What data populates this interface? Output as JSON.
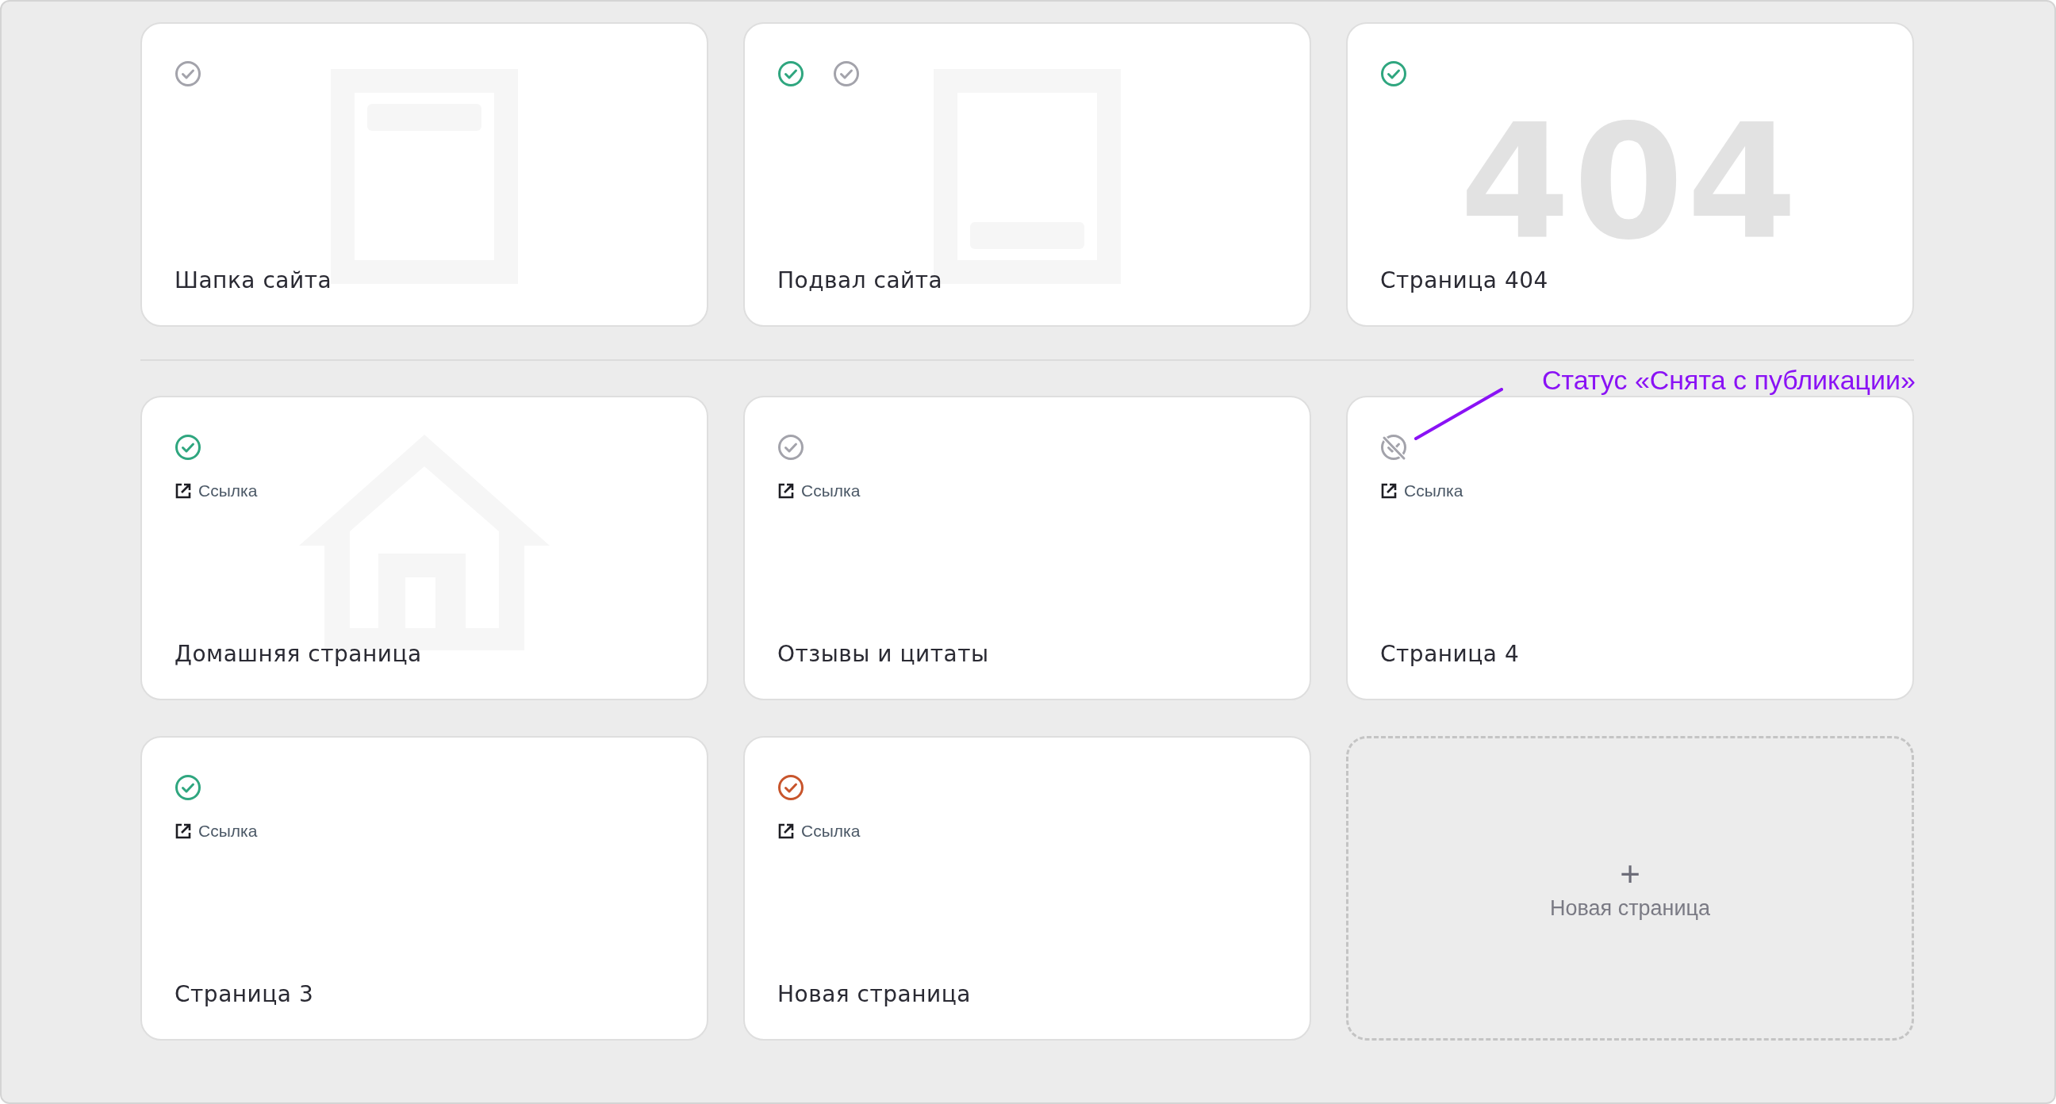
{
  "sections": [
    {
      "cards": [
        {
          "kind": "page",
          "title": "Шапка сайта",
          "illustration": {
            "kind": "header"
          },
          "statuses": [
            {
              "kind": "inactive"
            }
          ]
        },
        {
          "kind": "page",
          "title": "Подвал сайта",
          "illustration": {
            "kind": "footer"
          },
          "statuses": [
            {
              "kind": "published"
            },
            {
              "kind": "inactive"
            }
          ]
        },
        {
          "kind": "page",
          "title": "Страница 404",
          "illustration": {
            "kind": "error-code",
            "text": "404"
          },
          "statuses": [
            {
              "kind": "published"
            }
          ]
        }
      ]
    },
    {
      "cards": [
        {
          "kind": "page",
          "title": "Домашняя страница",
          "illustration": {
            "kind": "home"
          },
          "statuses": [
            {
              "kind": "published"
            }
          ],
          "link": "Ссылка"
        },
        {
          "kind": "page",
          "title": "Отзывы и цитаты",
          "statuses": [
            {
              "kind": "inactive"
            }
          ],
          "link": "Ссылка"
        },
        {
          "kind": "page",
          "title": "Страница 4",
          "statuses": [
            {
              "kind": "unpublished"
            }
          ],
          "link": "Ссылка"
        },
        {
          "kind": "page",
          "title": "Страница 3",
          "statuses": [
            {
              "kind": "published"
            }
          ],
          "link": "Ссылка"
        },
        {
          "kind": "page",
          "title": "Новая страница",
          "statuses": [
            {
              "kind": "error"
            }
          ],
          "link": "Ссылка"
        },
        {
          "kind": "add",
          "icon_text": "+",
          "label": "Новая страница"
        }
      ]
    }
  ],
  "annotation": {
    "text": "Статус «Снята с публикации»"
  }
}
